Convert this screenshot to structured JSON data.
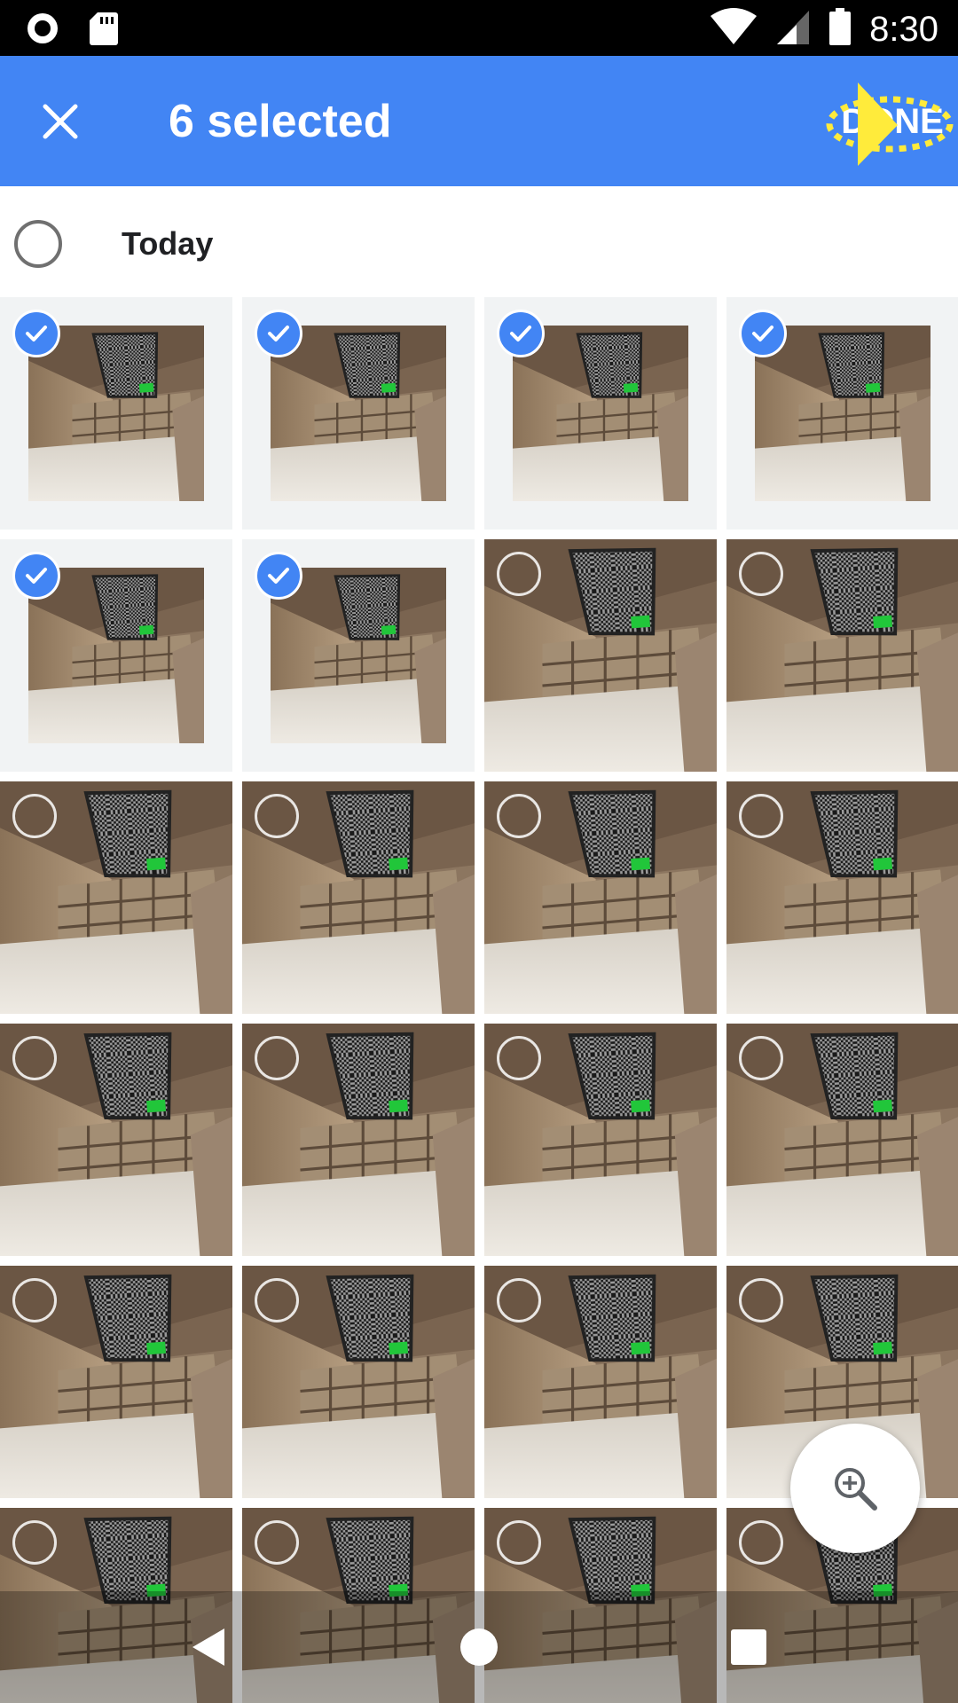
{
  "status_bar": {
    "time": "8:30",
    "icons": [
      "record-icon",
      "sd-card-icon",
      "wifi-icon",
      "cell-signal-icon",
      "battery-icon"
    ]
  },
  "app_bar": {
    "title": "6 selected",
    "done_label": "DONE",
    "close_icon": "close-icon"
  },
  "section": {
    "title": "Today"
  },
  "photos": [
    {
      "selected": true
    },
    {
      "selected": true
    },
    {
      "selected": true
    },
    {
      "selected": true
    },
    {
      "selected": true
    },
    {
      "selected": true
    },
    {
      "selected": false
    },
    {
      "selected": false
    },
    {
      "selected": false
    },
    {
      "selected": false
    },
    {
      "selected": false
    },
    {
      "selected": false
    },
    {
      "selected": false
    },
    {
      "selected": false
    },
    {
      "selected": false
    },
    {
      "selected": false
    },
    {
      "selected": false
    },
    {
      "selected": false
    },
    {
      "selected": false
    },
    {
      "selected": false
    },
    {
      "selected": false
    },
    {
      "selected": false
    },
    {
      "selected": false
    },
    {
      "selected": false
    }
  ],
  "fab": {
    "icon": "zoom-in-icon"
  },
  "nav": {
    "icons": [
      "back-icon",
      "home-icon",
      "recents-icon"
    ]
  },
  "colors": {
    "app_bar": "#4285f4",
    "check_selected": "#4285f4",
    "status_bar": "#000000",
    "tap_indicator": "#ffeb3b"
  }
}
